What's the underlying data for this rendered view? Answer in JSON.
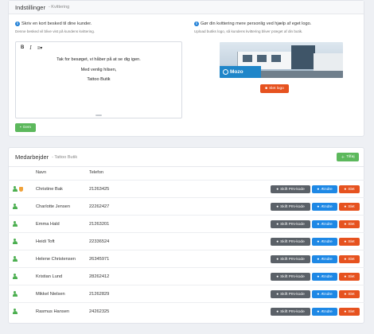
{
  "settings": {
    "title": "Indstillinger",
    "subtitle": "- Kvittering",
    "message_info": "Skriv en kort besked til dine kunder.",
    "message_sub": "Denne besked vil blive vist på kundens kvittering.",
    "logo_info": "Gør din kvittering mere personlig ved hjælp af eget logo.",
    "logo_sub": "Upload butiks logo, så kundens kvittering bliver præget af din butik.",
    "editor": {
      "bold": "B",
      "italic": "I",
      "lines": [
        "Tak for besøget, vi håber på at se dig igen.",
        "Med venlig hilsen,",
        "Tattoo Butik"
      ]
    },
    "logo_text": "Mozo",
    "delete_logo_label": "Slet logo",
    "save_label": "Gem"
  },
  "staff": {
    "title": "Medarbejder",
    "subtitle": "- Tattoo Butik",
    "add_label": "Tilføj",
    "columns": [
      "Navn",
      "Telefon"
    ],
    "actions": {
      "pin": "Skift PIN-kode",
      "edit": "Ændre",
      "delete": "Slet"
    },
    "rows": [
      {
        "name": "Christine Bak",
        "phone": "21263425"
      },
      {
        "name": "Charlotte Jensen",
        "phone": "22262427"
      },
      {
        "name": "Emma Hald",
        "phone": "21263201"
      },
      {
        "name": "Heidi Toft",
        "phone": "22336524"
      },
      {
        "name": "Helene Christensen",
        "phone": "26345971"
      },
      {
        "name": "Kristian Lund",
        "phone": "28262412"
      },
      {
        "name": "Mikkel Nielsen",
        "phone": "21262829"
      },
      {
        "name": "Rasmus Hansen",
        "phone": "24262325"
      }
    ]
  },
  "colors": {
    "green": "#5cb85c",
    "red": "#e6521f",
    "blue": "#1e88e5",
    "dark": "#5b6168",
    "info": "#1d7ed6"
  },
  "icons": {
    "info": "info-circle-icon",
    "user": "user-icon",
    "owner": "shield-icon",
    "add": "user-plus-icon",
    "save": "save-icon",
    "trash": "trash-icon"
  }
}
